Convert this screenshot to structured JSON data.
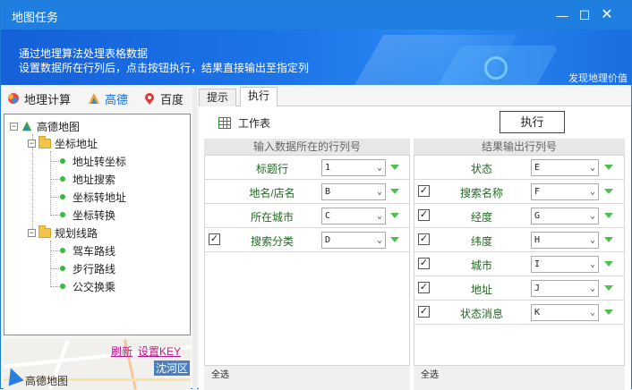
{
  "window": {
    "title": "地图任务"
  },
  "banner": {
    "line1": "通过地理算法处理表格数据",
    "line2": "设置数据所在行列后，点击按钮执行，结果直接输出至指定列",
    "brand": "发现地理价值"
  },
  "left_tabs": [
    {
      "label": "地理计算",
      "icon": "globe-icon"
    },
    {
      "label": "高德",
      "icon": "gaode-logo-icon"
    },
    {
      "label": "百度",
      "icon": "baidu-logo-icon"
    }
  ],
  "tree": {
    "root": "高德地图",
    "groups": [
      {
        "label": "坐标地址",
        "items": [
          "地址转坐标",
          "地址搜索",
          "坐标转地址",
          "坐标转换"
        ]
      },
      {
        "label": "规划线路",
        "items": [
          "驾车路线",
          "步行路线",
          "公交换乘"
        ]
      }
    ]
  },
  "map": {
    "refresh": "刷新",
    "set_key": "设置KEY",
    "district": "沈河区",
    "label": "高德地图"
  },
  "tabs": [
    {
      "label": "提示"
    },
    {
      "label": "执行"
    }
  ],
  "execute": {
    "worksheet_label": "工作表",
    "execute_button": "执行",
    "input_header": "输入数据所在的行列号",
    "output_header": "结果输出行列号",
    "select_all": "全选",
    "inputs": [
      {
        "label": "标题行",
        "value": "1",
        "checkbox": false,
        "checked": false
      },
      {
        "label": "地名/店名",
        "value": "B",
        "checkbox": false,
        "checked": false
      },
      {
        "label": "所在城市",
        "value": "C",
        "checkbox": false,
        "checked": false
      },
      {
        "label": "搜索分类",
        "value": "D",
        "checkbox": true,
        "checked": true
      }
    ],
    "outputs": [
      {
        "label": "状态",
        "value": "E",
        "checkbox": false,
        "checked": false
      },
      {
        "label": "搜索名称",
        "value": "F",
        "checkbox": true,
        "checked": true
      },
      {
        "label": "经度",
        "value": "G",
        "checkbox": true,
        "checked": true
      },
      {
        "label": "纬度",
        "value": "H",
        "checkbox": true,
        "checked": true
      },
      {
        "label": "城市",
        "value": "I",
        "checkbox": true,
        "checked": true
      },
      {
        "label": "地址",
        "value": "J",
        "checkbox": true,
        "checked": true
      },
      {
        "label": "状态消息",
        "value": "K",
        "checkbox": true,
        "checked": true
      }
    ]
  }
}
